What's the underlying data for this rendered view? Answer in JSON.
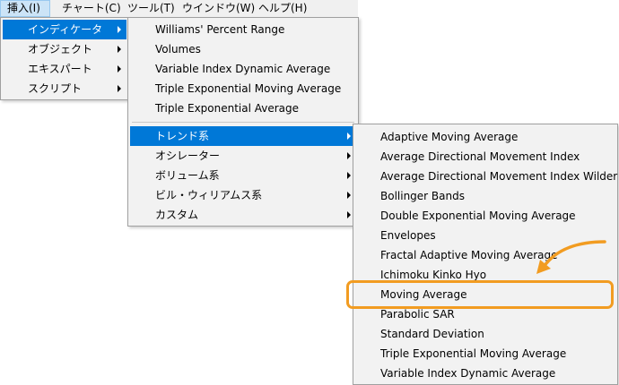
{
  "menubar": {
    "items": [
      {
        "label": "挿入(I)"
      },
      {
        "label": "チャート(C)"
      },
      {
        "label": "ツール(T)"
      },
      {
        "label": "ウインドウ(W)"
      },
      {
        "label": "ヘルプ(H)"
      }
    ]
  },
  "insert_menu": {
    "items": [
      {
        "label": "インディケータ"
      },
      {
        "label": "オブジェクト"
      },
      {
        "label": "エキスパート"
      },
      {
        "label": "スクリプト"
      }
    ]
  },
  "indicators_menu": {
    "items": [
      {
        "label": "Williams' Percent Range"
      },
      {
        "label": "Volumes"
      },
      {
        "label": "Variable Index Dynamic Average"
      },
      {
        "label": "Triple Exponential Moving Average"
      },
      {
        "label": "Triple Exponential Average"
      }
    ],
    "categories": [
      {
        "label": "トレンド系"
      },
      {
        "label": "オシレーター"
      },
      {
        "label": "ボリューム系"
      },
      {
        "label": "ビル・ウィリアムス系"
      },
      {
        "label": "カスタム"
      }
    ]
  },
  "trend_menu": {
    "items": [
      {
        "label": "Adaptive Moving Average"
      },
      {
        "label": "Average Directional Movement Index"
      },
      {
        "label": "Average Directional Movement Index Wilder"
      },
      {
        "label": "Bollinger Bands"
      },
      {
        "label": "Double Exponential Moving Average"
      },
      {
        "label": "Envelopes"
      },
      {
        "label": "Fractal Adaptive Moving Average"
      },
      {
        "label": "Ichimoku Kinko Hyo"
      },
      {
        "label": "Moving Average"
      },
      {
        "label": "Parabolic SAR"
      },
      {
        "label": "Standard Deviation"
      },
      {
        "label": "Triple Exponential Moving Average"
      },
      {
        "label": "Variable Index Dynamic Average"
      }
    ]
  },
  "colors": {
    "menu_highlight": "#0078d7",
    "callout": "#f29c21"
  }
}
